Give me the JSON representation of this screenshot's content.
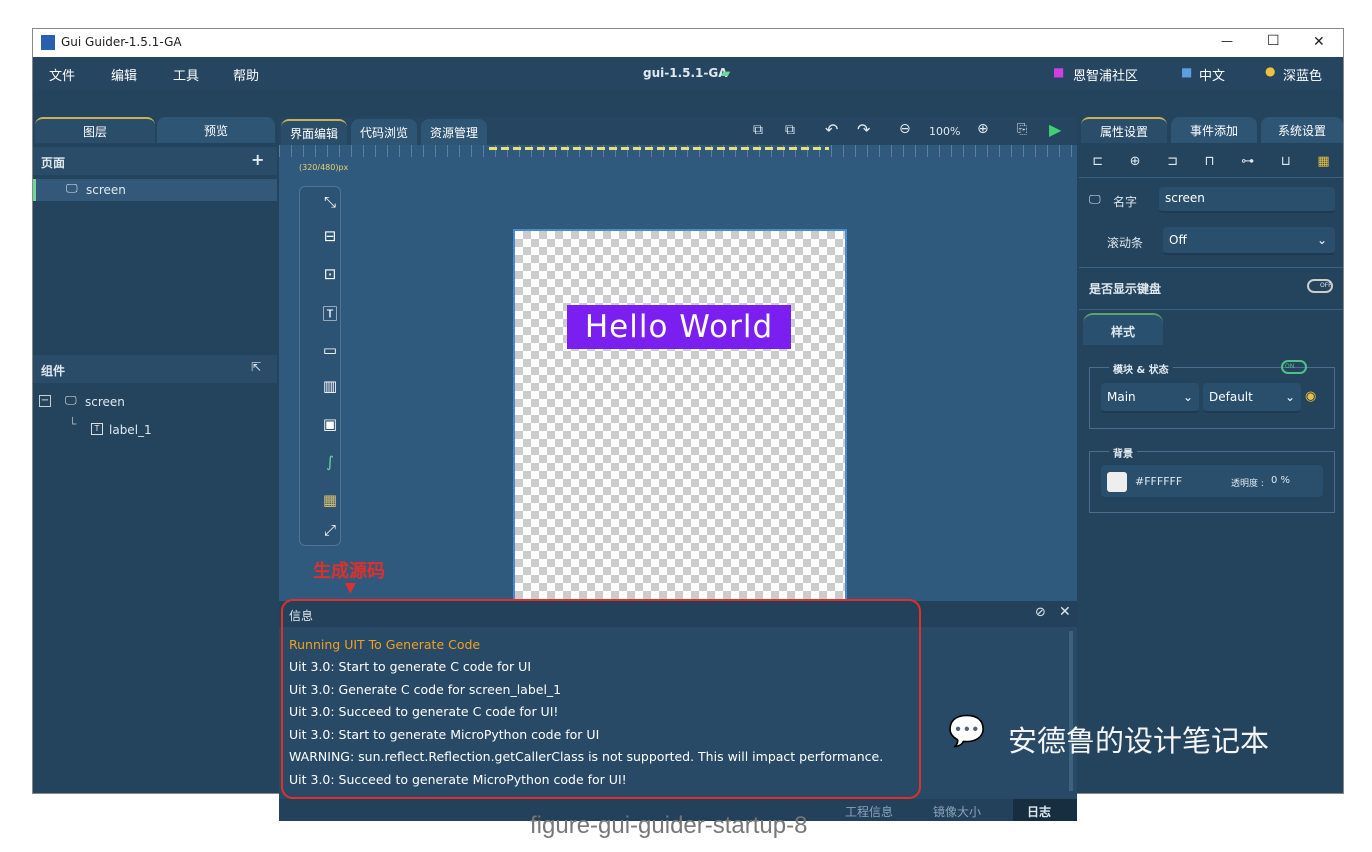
{
  "window": {
    "title": "Gui Guider-1.5.1-GA",
    "project": "gui-1.5.1-GA",
    "minimize": "—",
    "maximize": "☐",
    "close": "✕"
  },
  "menu": [
    "文件",
    "编辑",
    "工具",
    "帮助"
  ],
  "menu_right": {
    "community": "恩智浦社区",
    "language": "中文",
    "theme": "深蓝色"
  },
  "left_tabs": [
    "图层",
    "预览"
  ],
  "pages": {
    "title": "页面",
    "add": "+",
    "items": [
      "screen"
    ]
  },
  "components": {
    "title": "组件",
    "tree": [
      "screen",
      "label_1"
    ]
  },
  "center_tabs": [
    "界面编辑",
    "代码浏览",
    "资源管理"
  ],
  "toolbar": {
    "zoom": "100%"
  },
  "canvas": {
    "size": "(320/480)px",
    "label_text": "Hello World",
    "label_bg": "#7b1ff0"
  },
  "annotation": {
    "text": "生成源码",
    "color": "#e0302a"
  },
  "info": {
    "title": "信息",
    "lines": [
      "Running UIT To Generate Code",
      "Uit 3.0: Start to generate C code for UI",
      "Uit 3.0: Generate C code for screen_label_1",
      "Uit 3.0: Succeed to generate C code for UI!",
      "Uit 3.0: Start to generate MicroPython code for UI",
      "WARNING: sun.reflect.Reflection.getCallerClass is not supported. This will impact performance.",
      "Uit 3.0: Succeed to generate MicroPython code for UI!"
    ],
    "first_color": "#f0a020"
  },
  "status": {
    "project_info": "工程信息",
    "image_size": "镜像大小",
    "log": "日志"
  },
  "right_tabs": [
    "属性设置",
    "事件添加",
    "系统设置"
  ],
  "props": {
    "name_label": "名字",
    "name_value": "screen",
    "scroll_label": "滚动条",
    "scroll_value": "Off",
    "keyboard_label": "是否显示键盘",
    "keyboard_state": "OFF",
    "style_tab": "样式",
    "part_state_label": "模块 & 状态",
    "part_toggle": "ON",
    "part": "Main",
    "state": "Default",
    "bg_label": "背景",
    "bg_color": "#FFFFFF",
    "opacity_label": "透明度 : ",
    "opacity_value": "0 %"
  },
  "watermark": "安德鲁的设计笔记本",
  "caption": "figure-gui-guider-startup-8"
}
